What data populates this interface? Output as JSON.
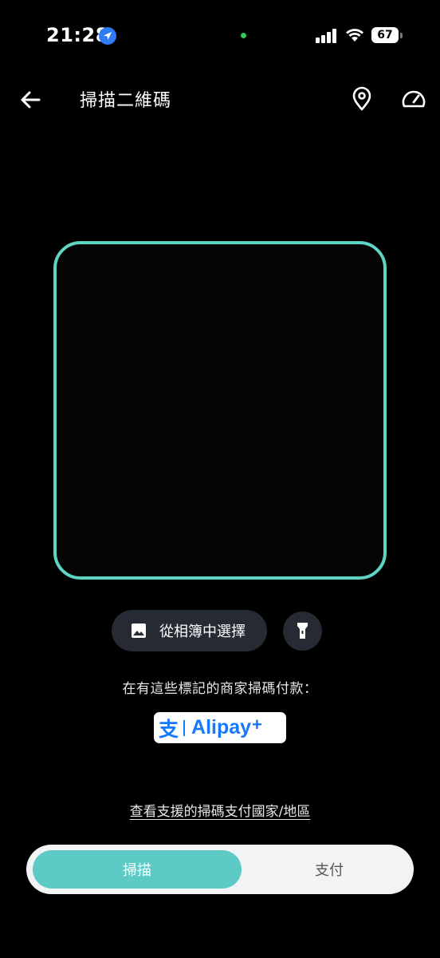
{
  "status_bar": {
    "time": "21:28",
    "battery": "67"
  },
  "header": {
    "title": "掃描二維碼"
  },
  "actions": {
    "album_label": "從相簿中選擇"
  },
  "hint_text": "在有這些標記的商家掃碼付款：",
  "alipay": {
    "mark": "支",
    "name": "Alipay",
    "plus": "+"
  },
  "countries_link": "查看支援的掃碼支付國家/地區",
  "tabs": [
    {
      "label": "掃描",
      "active": true
    },
    {
      "label": "支付",
      "active": false
    }
  ],
  "colors": {
    "accent": "#5fd4c4",
    "segment_active": "#5ecac6",
    "alipay_blue": "#1677ff",
    "button_bg": "#262a33"
  }
}
